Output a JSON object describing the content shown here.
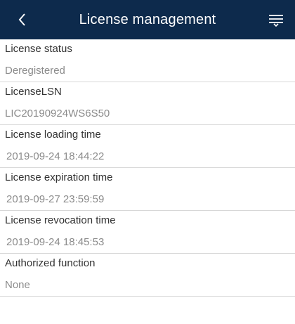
{
  "header": {
    "title": "License management",
    "back_icon": "chevron-left-icon",
    "menu_icon": "hamburger-menu-icon",
    "background": "#0d2a4c"
  },
  "items": [
    {
      "label": "License status",
      "value": "Deregistered"
    },
    {
      "label": "LicenseLSN",
      "value": "LIC20190924WS6S50"
    },
    {
      "label": "License loading time",
      "value": "2019-09-24 18:44:22"
    },
    {
      "label": "License expiration time",
      "value": "2019-09-27 23:59:59"
    },
    {
      "label": "License revocation time",
      "value": "2019-09-24 18:45:53"
    },
    {
      "label": "Authorized function",
      "value": "None"
    }
  ]
}
